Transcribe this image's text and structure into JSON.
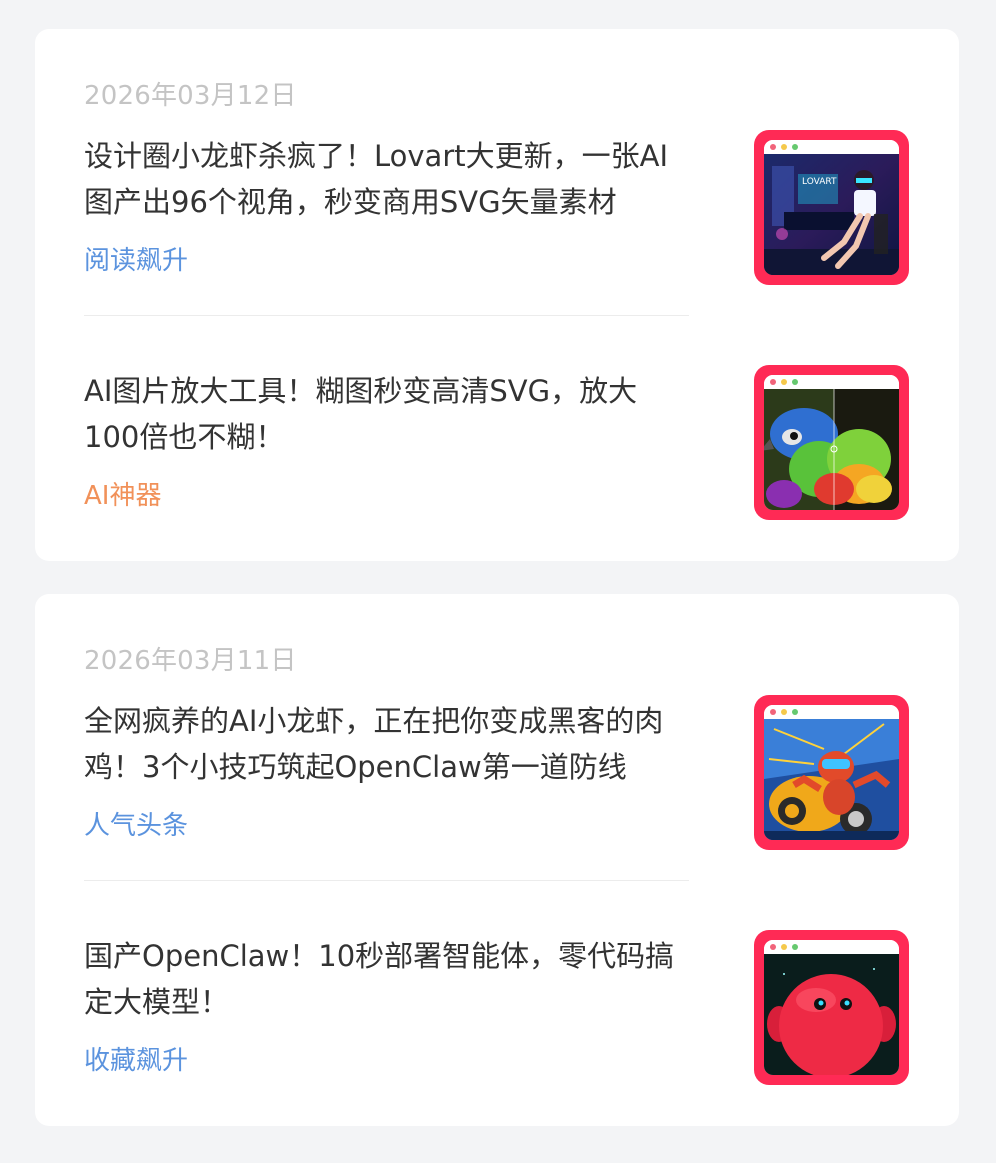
{
  "groups": [
    {
      "date": "2026年03月12日",
      "articles": [
        {
          "title": "设计圈小龙虾杀疯了！Lovart大更新，一张AI图产出96个视角，秒变商用SVG矢量素材",
          "tag": "阅读飙升",
          "tag_color": "#5b93de",
          "thumb_icon": "cyberpunk-girl-image"
        },
        {
          "title": "AI图片放大工具！糊图秒变高清SVG，放大100倍也不糊！",
          "tag": "AI神器",
          "tag_color": "#f19159",
          "thumb_icon": "parrot-image"
        }
      ]
    },
    {
      "date": "2026年03月11日",
      "articles": [
        {
          "title": "全网疯养的AI小龙虾，正在把你变成黑客的肉鸡！3个小技巧筑起OpenClaw第一道防线",
          "tag": "人气头条",
          "tag_color": "#5b93de",
          "thumb_icon": "robot-lobster-image"
        },
        {
          "title": "国产OpenClaw！10秒部署智能体，零代码搞定大模型！",
          "tag": "收藏飙升",
          "tag_color": "#5b93de",
          "thumb_icon": "red-creature-image"
        }
      ]
    }
  ],
  "thumb_frame_color": "#ff2a55"
}
